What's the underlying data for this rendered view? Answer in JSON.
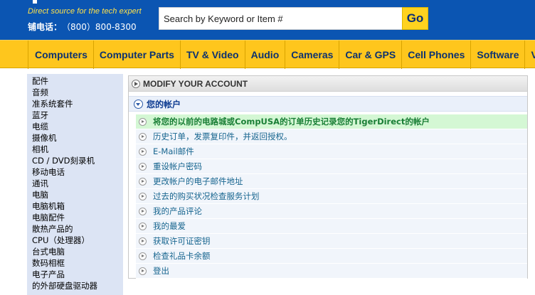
{
  "header": {
    "tagline": "Direct source for the tech expert",
    "phone_label": "铺电话：",
    "phone_number": "（800）800-8300",
    "search_placeholder": "Search by Keyword or Item #",
    "go_label": "Go",
    "brand_color": "#0b55b2",
    "accent_color": "#ffd21f"
  },
  "nav": {
    "items": [
      "Computers",
      "Computer Parts",
      "TV & Video",
      "Audio",
      "Cameras",
      "Car & GPS",
      "Cell Phones",
      "Software",
      "Vi"
    ]
  },
  "sidebar": {
    "items": [
      "配件",
      "音频",
      "准系统套件",
      "蓝牙",
      "电缆",
      "摄像机",
      "相机",
      "CD / DVD刻录机",
      "移动电话",
      "通讯",
      "电脑",
      "电脑机箱",
      "电脑配件",
      "散热产品的",
      "CPU（处理器）",
      "台式电脑",
      "数码相框",
      "电子产品",
      "的外部硬盘驱动器"
    ]
  },
  "main": {
    "modify_title": "MODIFY YOUR ACCOUNT",
    "account_title": "您的帐户",
    "links": [
      "将您的以前的电路城或CompUSA的订单历史记录您的TigerDirect的帐户",
      "历史订单，发票复印件，并返回授权。",
      "E-Mail邮件",
      "重设帐户密码",
      "更改帐户的电子邮件地址",
      "过去的购买状况检查服务计划",
      "我的产品评论",
      "我的最爱",
      "获取许可证密钥",
      "检查礼品卡余额",
      "登出"
    ],
    "highlight_color": "#d4f7d4"
  }
}
